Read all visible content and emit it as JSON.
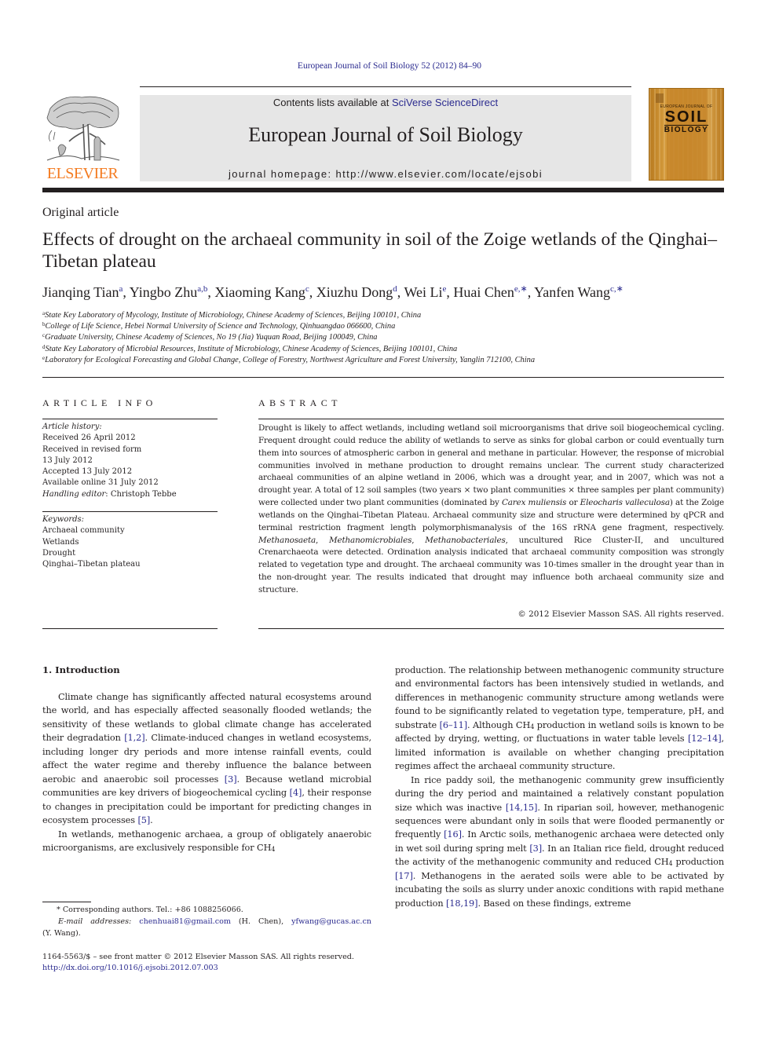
{
  "header": {
    "citation": "European Journal of Soil Biology 52 (2012) 84–90",
    "contents_prefix": "Contents lists available at ",
    "contents_link": "SciVerse ScienceDirect",
    "journal_name": "European Journal of Soil Biology",
    "homepage": "journal homepage: http://www.elsevier.com/locate/ejsobi",
    "publisher_logo_text": "ELSEVIER",
    "publisher_logo_icon": "tree-engraving-icon",
    "cover": {
      "small_text": "EUROPEAN JOURNAL OF",
      "big_text": "SOIL",
      "sub_text": "BIOLOGY"
    },
    "colors": {
      "elsevier_orange": "#f47b20",
      "link_blue": "#2b2b8f",
      "masthead_gray": "#e6e6e6",
      "cover_orange": "#c98a2a"
    }
  },
  "article": {
    "type": "Original article",
    "title": "Effects of drought on the archaeal community in soil of the Zoige wetlands of the Qinghai–Tibetan plateau",
    "authors": [
      {
        "name": "Jianqing Tian",
        "sup": "a",
        "sep": ", "
      },
      {
        "name": "Yingbo Zhu",
        "sup": "a,b",
        "sep": ", "
      },
      {
        "name": "Xiaoming Kang",
        "sup": "c",
        "sep": ", "
      },
      {
        "name": "Xiuzhu Dong",
        "sup": "d",
        "sep": ", "
      },
      {
        "name": "Wei Li",
        "sup": "e",
        "sep": ", "
      },
      {
        "name": "Huai Chen",
        "sup": "e,∗",
        "sep": ", "
      },
      {
        "name": "Yanfen Wang",
        "sup": "c,∗",
        "sep": ""
      }
    ],
    "affiliations": [
      {
        "key": "a",
        "text": "State Key Laboratory of Mycology, Institute of Microbiology, Chinese Academy of Sciences, Beijing 100101, China"
      },
      {
        "key": "b",
        "text": "College of Life Science, Hebei Normal University of Science and Technology, Qinhuangdao 066600, China"
      },
      {
        "key": "c",
        "text": "Graduate University, Chinese Academy of Sciences, No 19 (Jia) Yuquan Road, Beijing 100049, China"
      },
      {
        "key": "d",
        "text": "State Key Laboratory of Microbial Resources, Institute of Microbiology, Chinese Academy of Sciences, Beijing 100101, China"
      },
      {
        "key": "e",
        "text": "Laboratory for Ecological Forecasting and Global Change, College of Forestry, Northwest Agriculture and Forest University, Yanglin 712100, China"
      }
    ]
  },
  "article_info": {
    "heading": "ARTICLE INFO",
    "history_label": "Article history:",
    "history": [
      "Received 26 April 2012",
      "Received in revised form",
      "13 July 2012",
      "Accepted 13 July 2012",
      "Available online 31 July 2012"
    ],
    "editor_label": "Handling editor",
    "editor_name": ": Christoph Tebbe",
    "keywords_label": "Keywords:",
    "keywords": [
      "Archaeal community",
      "Wetlands",
      "Drought",
      "Qinghai–Tibetan plateau"
    ]
  },
  "abstract": {
    "heading": "ABSTRACT",
    "parts": [
      {
        "t": "Drought is likely to affect wetlands, including wetland soil microorganisms that drive soil biogeochemical cycling. Frequent drought could reduce the ability of wetlands to serve as sinks for global carbon or could eventually turn them into sources of atmospheric carbon in general and methane in particular. However, the response of microbial communities involved in methane production to drought remains unclear. The current study characterized archaeal communities of an alpine wetland in 2006, which was a drought year, and in 2007, which was not a drought year. A total of 12 soil samples (two years × two plant communities × three samples per plant community) were collected under two plant communities (dominated by ",
        "i": false
      },
      {
        "t": "Carex muliensis",
        "i": true
      },
      {
        "t": " or ",
        "i": false
      },
      {
        "t": "Eleocharis valleculosa",
        "i": true
      },
      {
        "t": ") at the Zoige wetlands on the Qinghai–Tibetan Plateau. Archaeal community size and structure were determined by qPCR and terminal restriction fragment length polymorphismanalysis of the 16S rRNA gene fragment, respectively. ",
        "i": false
      },
      {
        "t": "Methanosaeta",
        "i": true
      },
      {
        "t": ", ",
        "i": false
      },
      {
        "t": "Methanomicrobiales",
        "i": true
      },
      {
        "t": ", ",
        "i": false
      },
      {
        "t": "Methanobacteriales",
        "i": true
      },
      {
        "t": ", uncultured Rice Cluster-II, and uncultured Crenarchaeota were detected. Ordination analysis indicated that archaeal community composition was strongly related to vegetation type and drought. The archaeal community was 10-times smaller in the drought year than in the non-drought year. The results indicated that drought may influence both archaeal community size and structure.",
        "i": false
      }
    ],
    "copyright": "© 2012 Elsevier Masson SAS. All rights reserved."
  },
  "introduction": {
    "heading": "1.  Introduction",
    "left_paragraphs": [
      [
        {
          "t": "Climate change has significantly affected natural ecosystems around the world, and has especially affected seasonally flooded wetlands; the sensitivity of these wetlands to global climate change has accelerated their degradation "
        },
        {
          "ref": "[1,2]"
        },
        {
          "t": ". Climate-induced changes in wetland ecosystems, including longer dry periods and more intense rainfall events, could affect the water regime and thereby influence the balance between aerobic and anaerobic soil processes "
        },
        {
          "ref": "[3]"
        },
        {
          "t": ". Because wetland microbial communities are key drivers of biogeochemical cycling "
        },
        {
          "ref": "[4]"
        },
        {
          "t": ", their response to changes in precipitation could be important for predicting changes in ecosystem processes "
        },
        {
          "ref": "[5]"
        },
        {
          "t": "."
        }
      ],
      [
        {
          "t": "In wetlands, methanogenic archaea, a group of obligately anaerobic microorganisms, are exclusively responsible for CH"
        },
        {
          "sub": "4"
        }
      ]
    ],
    "right_paragraphs": [
      [
        {
          "t": "production. The relationship between methanogenic community structure and environmental factors has been intensively studied in wetlands, and differences in methanogenic community structure among wetlands were found to be significantly related to vegetation type, temperature, pH, and substrate "
        },
        {
          "ref": "[6–11]"
        },
        {
          "t": ". Although CH"
        },
        {
          "sub": "4"
        },
        {
          "t": " production in wetland soils is known to be affected by drying, wetting, or fluctuations in water table levels "
        },
        {
          "ref": "[12–14]"
        },
        {
          "t": ", limited information is available on whether changing precipitation regimes affect the archaeal community structure."
        }
      ],
      [
        {
          "t": "In rice paddy soil, the methanogenic community grew insufficiently during the dry period and maintained a relatively constant population size which was inactive "
        },
        {
          "ref": "[14,15]"
        },
        {
          "t": ". In riparian soil, however, methanogenic sequences were abundant only in soils that were flooded permanently or frequently "
        },
        {
          "ref": "[16]"
        },
        {
          "t": ". In Arctic soils, methanogenic archaea were detected only in wet soil during spring melt "
        },
        {
          "ref": "[3]"
        },
        {
          "t": ". In an Italian rice field, drought reduced the activity of the methanogenic community and reduced CH"
        },
        {
          "sub": "4"
        },
        {
          "t": " production "
        },
        {
          "ref": "[17]"
        },
        {
          "t": ". Methanogens in the aerated soils were able to be activated by incubating the soils as slurry under anoxic conditions with rapid methane production "
        },
        {
          "ref": "[18,19]"
        },
        {
          "t": ". Based on these findings, extreme"
        }
      ]
    ]
  },
  "footnotes": {
    "corresponding": "* Corresponding authors. Tel.: +86 1088256066.",
    "email_label": "E-mail addresses:",
    "email1": "chenhuai81@gmail.com",
    "email1_owner": " (H. Chen), ",
    "email2": "yfwang@gucas.ac.cn",
    "email2_owner": " (Y. Wang).",
    "front_matter": "1164-5563/$ – see front matter © 2012 Elsevier Masson SAS. All rights reserved.",
    "doi": "http://dx.doi.org/10.1016/j.ejsobi.2012.07.003"
  }
}
